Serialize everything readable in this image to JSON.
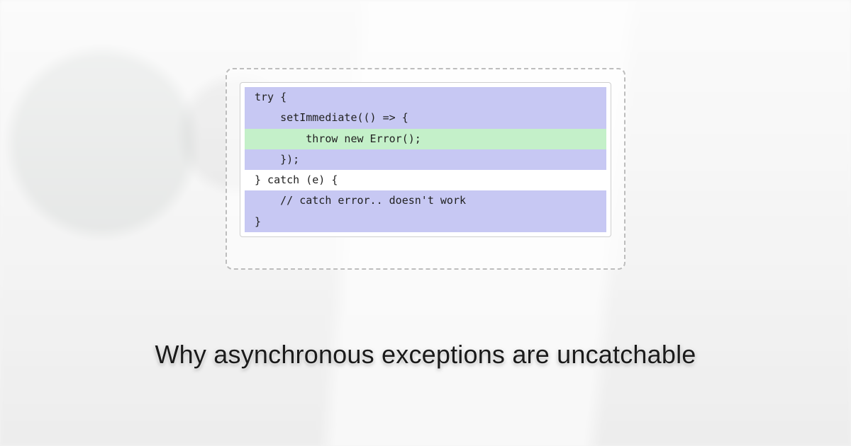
{
  "code": {
    "lines": [
      {
        "text": "try {",
        "hl": "purple"
      },
      {
        "text": "    setImmediate(() => {",
        "hl": "purple"
      },
      {
        "text": "        throw new Error();",
        "hl": "green"
      },
      {
        "text": "    });",
        "hl": "purple"
      },
      {
        "text": "} catch (e) {",
        "hl": "none"
      },
      {
        "text": "    // catch error.. doesn't work",
        "hl": "purple"
      },
      {
        "text": "}",
        "hl": "purple"
      }
    ]
  },
  "title": "Why asynchronous exceptions are uncatchable"
}
